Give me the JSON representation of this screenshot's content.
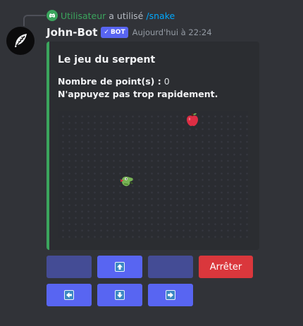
{
  "reply": {
    "user": "Utilisateur",
    "action": "a utilisé",
    "command": "/snake",
    "icon": "discord-logo-icon"
  },
  "message": {
    "author": "John-Bot",
    "badge": "BOT",
    "timestamp": "Aujourd'hui à 22:24",
    "avatar_icon": "feather-icon"
  },
  "embed": {
    "title": "Le jeu du serpent",
    "score_label": "Nombre de point(s) :",
    "score_value": "0",
    "warning": "N'appuyez pas trop rapidement.",
    "accent_color": "#3ba55d",
    "board": {
      "apple_icon": "red-apple-icon",
      "snake_icon": "snake-head-icon"
    }
  },
  "buttons": {
    "row1": [
      {
        "name": "empty-button-left",
        "label": "",
        "state": "disabled"
      },
      {
        "name": "up-button",
        "icon": "arrow-up-icon",
        "state": "primary"
      },
      {
        "name": "empty-button-right",
        "label": "",
        "state": "disabled"
      },
      {
        "name": "stop-button",
        "label": "Arrêter",
        "state": "danger"
      }
    ],
    "row2": [
      {
        "name": "left-button",
        "icon": "arrow-left-icon",
        "state": "primary"
      },
      {
        "name": "down-button",
        "icon": "arrow-down-icon",
        "state": "primary"
      },
      {
        "name": "right-button",
        "icon": "arrow-right-icon",
        "state": "primary"
      }
    ]
  },
  "colors": {
    "background": "#313338",
    "embed_bg": "#2b2d31",
    "blurple": "#5865f2",
    "danger": "#da373c",
    "green": "#3ba55d",
    "link": "#00a8fc"
  }
}
